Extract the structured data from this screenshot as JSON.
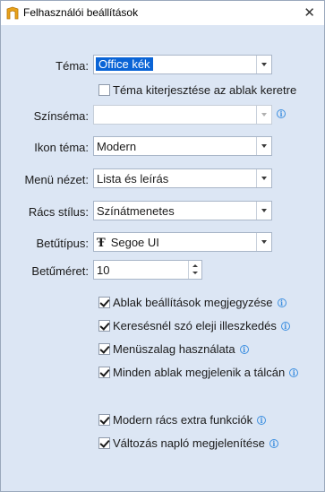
{
  "window": {
    "title": "Felhasználói beállítások",
    "close_glyph": "✕"
  },
  "fields": {
    "tema": {
      "label": "Téma:",
      "value": "Office kék"
    },
    "tema_keret": {
      "label": "Téma kiterjesztése az ablak keretre",
      "checked": false
    },
    "szinsema": {
      "label": "Színséma:",
      "value": ""
    },
    "ikon_tema": {
      "label": "Ikon téma:",
      "value": "Modern"
    },
    "menu_nezet": {
      "label": "Menü nézet:",
      "value": "Lista és leírás"
    },
    "racs_stilus": {
      "label": "Rács stílus:",
      "value": "Színátmenetes"
    },
    "betutipus": {
      "label": "Betűtípus:",
      "value": "Segoe UI",
      "icon": "font-icon"
    },
    "betumeret": {
      "label": "Betűméret:",
      "value": "10"
    }
  },
  "checkboxes": [
    {
      "label": "Ablak beállítások megjegyzése",
      "checked": true
    },
    {
      "label": "Keresésnél szó eleji illeszkedés",
      "checked": true
    },
    {
      "label": "Menüszalag használata",
      "checked": true
    },
    {
      "label": "Minden ablak megjelenik a tálcán",
      "checked": true
    },
    {
      "label": "Modern rács extra funkciók",
      "checked": true
    },
    {
      "label": "Változás napló megjelenítése",
      "checked": true
    }
  ],
  "info_glyph": "i",
  "colors": {
    "selection": "#0a64d6",
    "background": "#dce6f4",
    "info": "#3d8fe0"
  }
}
